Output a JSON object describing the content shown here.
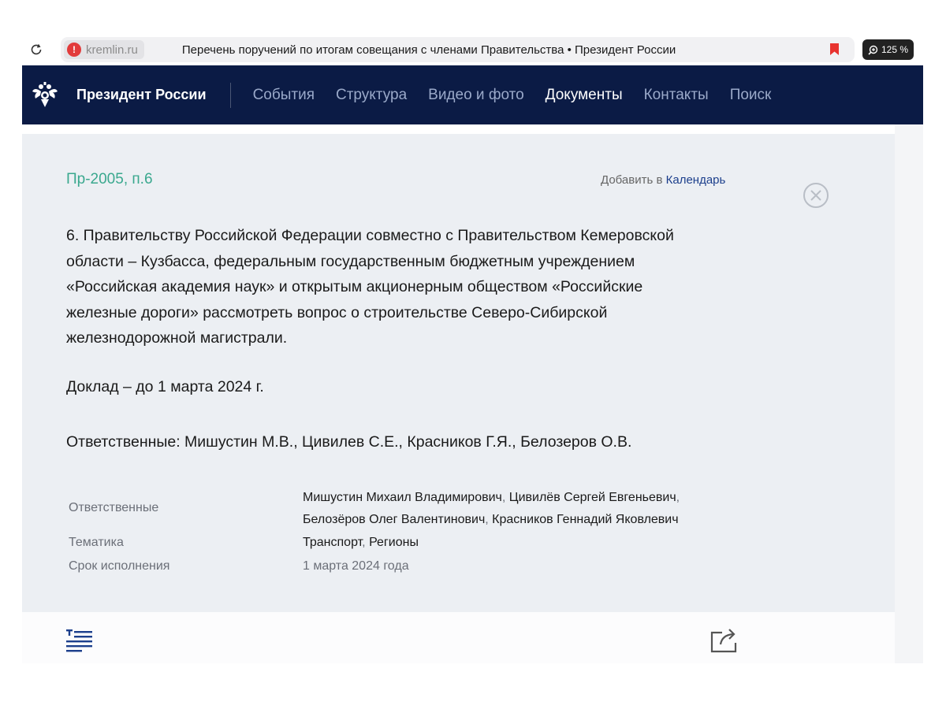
{
  "browser": {
    "domain": "kremlin.ru",
    "tab_title": "Перечень поручений по итогам совещания с членами Правительства • Президент России",
    "zoom": "125 %"
  },
  "header": {
    "brand": "Президент России",
    "nav": [
      {
        "label": "События",
        "active": false
      },
      {
        "label": "Структура",
        "active": false
      },
      {
        "label": "Видео и фото",
        "active": false
      },
      {
        "label": "Документы",
        "active": true
      },
      {
        "label": "Контакты",
        "active": false
      },
      {
        "label": "Поиск",
        "active": false
      }
    ]
  },
  "document": {
    "number": "Пр-2005, п.6",
    "add_to_prefix": "Добавить в ",
    "calendar_link": "Календарь",
    "body_lines": [
      "6. Правительству Российской Федерации совместно с Правительством Кемеровской",
      "области – Кузбасса, федеральным государственным бюджетным учреждением",
      "«Российская академия наук» и открытым акционерным обществом «Российские",
      "железные дороги» рассмотреть вопрос о строительстве Северо-Сибирской",
      "железнодорожной магистрали."
    ],
    "deadline_text": "Доклад – до 1 марта 2024 г.",
    "responsible_text": "Ответственные: Мишустин М.В., Цивилев С.Е., Красников Г.Я., Белозеров О.В."
  },
  "meta": {
    "responsible_label": "Ответственные",
    "responsible_people": [
      "Мишустин Михаил Владимирович",
      "Цивилёв Сергей Евгеньевич",
      "Белозёров Олег Валентинович",
      "Красников Геннадий Яковлевич"
    ],
    "separator": ", ",
    "topic_label": "Тематика",
    "topics": [
      "Транспорт",
      "Регионы"
    ],
    "due_label": "Срок исполнения",
    "due_value": "1 марта 2024 года"
  },
  "colors": {
    "header_bg": "#0b1b45",
    "doc_number": "#3aa88e",
    "link": "#1c3f8c",
    "card_bg": "#eceff3"
  },
  "icons": {
    "reload": "reload-icon",
    "warning": "warning-icon",
    "bookmark": "bookmark-icon",
    "zoom": "zoom-icon",
    "emblem": "emblem-icon",
    "close": "close-circle-icon",
    "toc": "toc-icon",
    "share": "share-icon"
  }
}
